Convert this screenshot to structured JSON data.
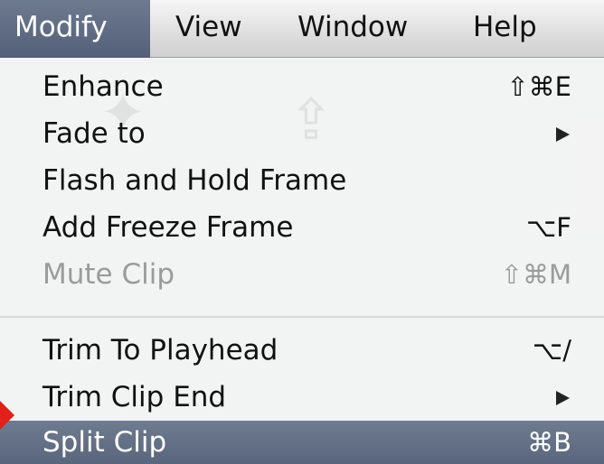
{
  "menubar": {
    "items": [
      {
        "label": "Modify",
        "active": true
      },
      {
        "label": "View"
      },
      {
        "label": "Window"
      },
      {
        "label": "Help"
      }
    ]
  },
  "menu": {
    "items": [
      {
        "label": "Enhance",
        "shortcut": "⇧⌘E"
      },
      {
        "label": "Fade to",
        "submenu": true
      },
      {
        "label": "Flash and Hold Frame",
        "shortcut": ""
      },
      {
        "label": "Add Freeze Frame",
        "shortcut": "⌥F"
      },
      {
        "label": "Mute Clip",
        "shortcut": "⇧⌘M",
        "disabled": true
      },
      {
        "label": "Trim To Playhead",
        "shortcut": "⌥/"
      },
      {
        "label": "Trim Clip End",
        "submenu": true
      },
      {
        "label": "Split Clip",
        "shortcut": "⌘B",
        "highlighted": true
      }
    ]
  },
  "colors": {
    "menubar_active": "#5f6b83",
    "highlight": "#64708a",
    "menu_background": "#f7f7f7",
    "disabled_text": "#9b9b9b",
    "pointer": "#e0201a"
  }
}
